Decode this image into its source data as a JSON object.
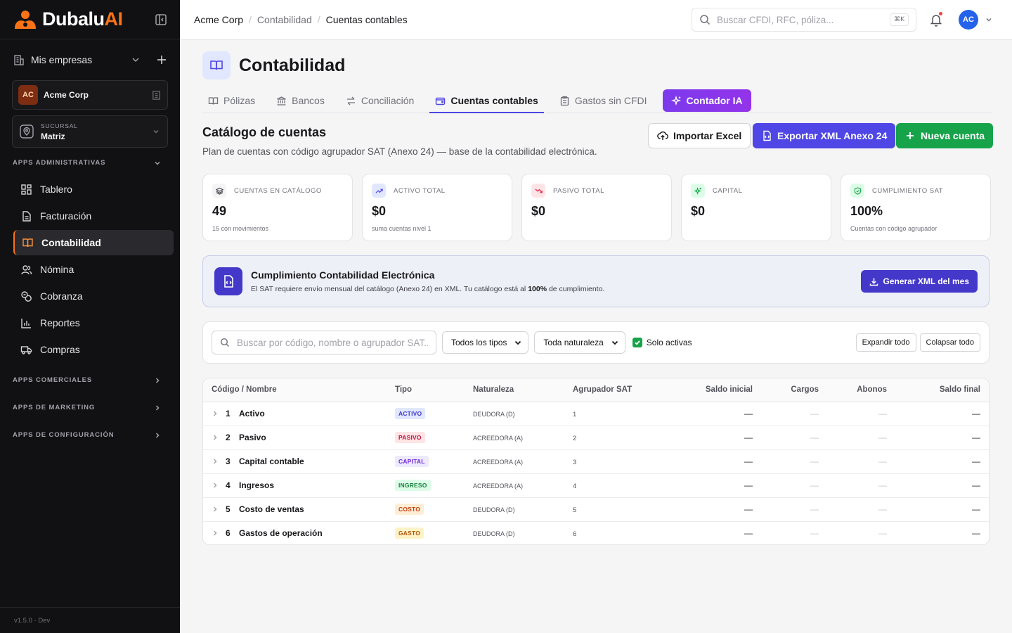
{
  "app": {
    "logo_main": "Dubalu",
    "logo_accent": "AI",
    "version": "v1.5.0 · Dev"
  },
  "sidebar": {
    "mis_empresas": "Mis empresas",
    "company": {
      "initials": "AC",
      "name": "Acme Corp"
    },
    "sucursal": {
      "label": "SUCURSAL",
      "value": "Matriz"
    },
    "sections": {
      "admin": "APPS ADMINISTRATIVAS",
      "comerciales": "APPS COMERCIALES",
      "marketing": "APPS DE MARKETING",
      "configuracion": "APPS DE CONFIGURACIÓN"
    },
    "items": [
      {
        "label": "Tablero",
        "icon": "grid-icon"
      },
      {
        "label": "Facturación",
        "icon": "document-icon"
      },
      {
        "label": "Contabilidad",
        "icon": "book-icon"
      },
      {
        "label": "Nómina",
        "icon": "users-icon"
      },
      {
        "label": "Cobranza",
        "icon": "coins-icon"
      },
      {
        "label": "Reportes",
        "icon": "bar-chart-icon"
      },
      {
        "label": "Compras",
        "icon": "truck-icon"
      }
    ]
  },
  "topbar": {
    "breadcrumb": [
      "Acme Corp",
      "Contabilidad",
      "Cuentas contables"
    ],
    "search_placeholder": "Buscar CFDI, RFC, póliza...",
    "shortcut": "⌘K",
    "user_initials": "AC"
  },
  "page": {
    "title": "Contabilidad",
    "tabs": [
      "Pólizas",
      "Bancos",
      "Conciliación",
      "Cuentas contables",
      "Gastos sin CFDI",
      "Contador IA"
    ],
    "active_tab": "Cuentas contables",
    "section_title": "Catálogo de cuentas",
    "section_subtitle": "Plan de cuentas con código agrupador SAT (Anexo 24) — base de la contabilidad electrónica.",
    "buttons": {
      "import": "Importar Excel",
      "export": "Exportar XML Anexo 24",
      "new": "Nueva cuenta"
    }
  },
  "stats": [
    {
      "label": "CUENTAS EN CATÁLOGO",
      "value": "49",
      "note": "15 con movimientos",
      "icon": "layers-icon",
      "color": "#f4f4f5",
      "fg": "#3f3f46"
    },
    {
      "label": "ACTIVO TOTAL",
      "value": "$0",
      "note": "suma cuentas nivel 1",
      "icon": "trend-up-icon",
      "color": "#e0e7ff",
      "fg": "#4f46e5"
    },
    {
      "label": "PASIVO TOTAL",
      "value": "$0",
      "note": "",
      "icon": "trend-down-icon",
      "color": "#ffe4e6",
      "fg": "#e11d48"
    },
    {
      "label": "CAPITAL",
      "value": "$0",
      "note": "",
      "icon": "sparkle-icon",
      "color": "#dcfce7",
      "fg": "#16a34a"
    },
    {
      "label": "CUMPLIMIENTO SAT",
      "value": "100%",
      "note": "Cuentas con código agrupador",
      "icon": "shield-check-icon",
      "color": "#dcfce7",
      "fg": "#16a34a"
    }
  ],
  "banner": {
    "title": "Cumplimiento Contabilidad Electrónica",
    "text_before": "El SAT requiere envío mensual del catálogo (Anexo 24) en XML. Tu catálogo está al ",
    "text_bold": "100%",
    "text_after": " de cumplimiento.",
    "button": "Generar XML del mes"
  },
  "filters": {
    "search_placeholder": "Buscar por código, nombre o agrupador SAT...",
    "type_select": "Todos los tipos",
    "nature_select": "Toda naturaleza",
    "only_active": "Solo activas",
    "expand": "Expandir todo",
    "collapse": "Colapsar todo"
  },
  "table": {
    "headers": [
      "Código / Nombre",
      "Tipo",
      "Naturaleza",
      "Agrupador SAT",
      "Saldo inicial",
      "Cargos",
      "Abonos",
      "Saldo final"
    ],
    "rows": [
      {
        "code": "1",
        "name": "Activo",
        "type": "ACTIVO",
        "type_bg": "#e0e7ff",
        "type_fg": "#4338ca",
        "nature": "DEUDORA (D)",
        "group": "1",
        "initial": "—",
        "charges": "—",
        "credits": "—",
        "final": "—"
      },
      {
        "code": "2",
        "name": "Pasivo",
        "type": "PASIVO",
        "type_bg": "#ffe4e6",
        "type_fg": "#be123c",
        "nature": "ACREEDORA (A)",
        "group": "2",
        "initial": "—",
        "charges": "—",
        "credits": "—",
        "final": "—"
      },
      {
        "code": "3",
        "name": "Capital contable",
        "type": "CAPITAL",
        "type_bg": "#ede9fe",
        "type_fg": "#6d28d9",
        "nature": "ACREEDORA (A)",
        "group": "3",
        "initial": "—",
        "charges": "—",
        "credits": "—",
        "final": "—"
      },
      {
        "code": "4",
        "name": "Ingresos",
        "type": "INGRESO",
        "type_bg": "#dcfce7",
        "type_fg": "#15803d",
        "nature": "ACREEDORA (A)",
        "group": "4",
        "initial": "—",
        "charges": "—",
        "credits": "—",
        "final": "—"
      },
      {
        "code": "5",
        "name": "Costo de ventas",
        "type": "COSTO",
        "type_bg": "#ffedd5",
        "type_fg": "#c2410c",
        "nature": "DEUDORA (D)",
        "group": "5",
        "initial": "—",
        "charges": "—",
        "credits": "—",
        "final": "—"
      },
      {
        "code": "6",
        "name": "Gastos de operación",
        "type": "GASTO",
        "type_bg": "#fef3c7",
        "type_fg": "#b45309",
        "nature": "DEUDORA (D)",
        "group": "6",
        "initial": "—",
        "charges": "—",
        "credits": "—",
        "final": "—"
      }
    ]
  }
}
